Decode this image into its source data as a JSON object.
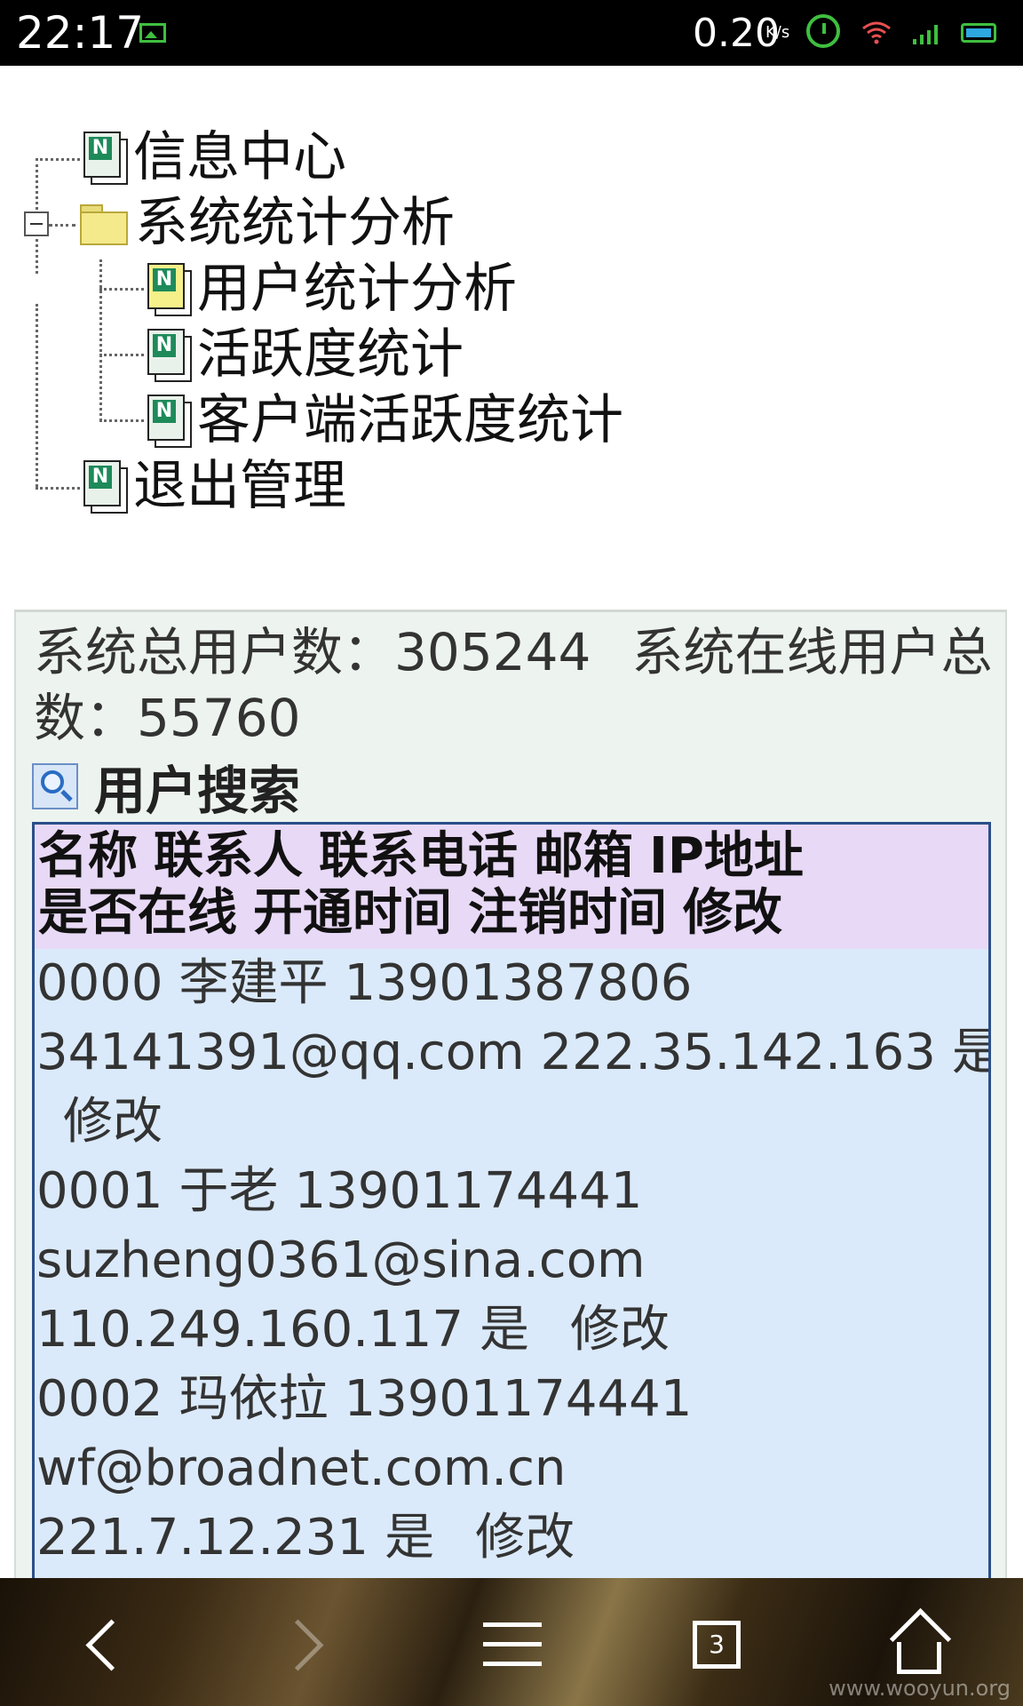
{
  "status_bar": {
    "time": "22:17",
    "net_speed": "0.20",
    "net_speed_unit": "K/s",
    "icons": [
      "image-notification-icon",
      "alarm-icon",
      "wifi-icon",
      "signal-icon",
      "battery-icon"
    ],
    "accent_color": "#3fbf3f"
  },
  "tree": {
    "items": [
      {
        "label": "信息中心",
        "icon": "document-icon"
      },
      {
        "label": "系统统计分析",
        "icon": "folder-icon",
        "expanded": true
      },
      {
        "label": "用户统计分析",
        "icon": "document-icon"
      },
      {
        "label": "活跃度统计",
        "icon": "document-icon"
      },
      {
        "label": "客户端活跃度统计",
        "icon": "document-icon"
      },
      {
        "label": "退出管理",
        "icon": "document-icon"
      }
    ]
  },
  "stats": {
    "total_label": "系统总用户数：",
    "total_value": "305244",
    "online_label": "系统在线用户总数：",
    "online_value": "55760"
  },
  "search": {
    "title": "用户搜索"
  },
  "table": {
    "columns": [
      "名称",
      "联系人",
      "联系电话",
      "邮箱",
      "IP地址",
      "是否在线",
      "开通时间",
      "注销时间",
      "修改"
    ],
    "rows": [
      {
        "name": "0000",
        "contact": "李建平",
        "phone": "13901387806",
        "email": "34141391@qq.com",
        "ip": "222.35.142.163",
        "online": "是",
        "action": "修改"
      },
      {
        "name": "0001",
        "contact": "于老",
        "phone": "13901174441",
        "email": "suzheng0361@sina.com",
        "ip": "110.249.160.117",
        "online": "是",
        "action": "修改"
      },
      {
        "name": "0002",
        "contact": "玛依拉",
        "phone": "13901174441",
        "email": "wf@broadnet.com.cn",
        "ip": "221.7.12.231",
        "online": "是",
        "action": "修改"
      }
    ]
  },
  "nav_bar": {
    "tab_count": "3",
    "watermark": "www.wooyun.org"
  }
}
